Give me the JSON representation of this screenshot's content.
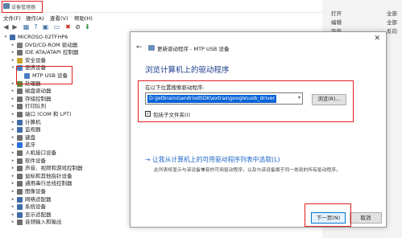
{
  "device_manager": {
    "title": "设备管理器",
    "menu": [
      "文件(F)",
      "操作(A)",
      "查看(V)",
      "帮助(H)"
    ],
    "toolbar_icons": [
      "back-icon",
      "forward-icon",
      "properties-icon",
      "help-icon",
      "refresh-icon",
      "monitor-icon",
      "remove-device-icon",
      "disable-icon",
      "update-driver-icon"
    ],
    "tree": [
      {
        "label": "MICROSO-02TFHP6",
        "level": 0,
        "expanded": true,
        "icon_color": "#3f6ca8"
      },
      {
        "label": "DVD/CD-ROM 驱动器",
        "level": 1,
        "expanded": false,
        "icon_color": "#7a7a7a"
      },
      {
        "label": "IDE ATA/ATAPI 控制器",
        "level": 1,
        "expanded": false,
        "icon_color": "#6d6d6d"
      },
      {
        "label": "安全设备",
        "level": 1,
        "expanded": false,
        "icon_color": "#c9a227"
      },
      {
        "label": "便携设备",
        "level": 1,
        "expanded": true,
        "icon_color": "#4a7fc0"
      },
      {
        "label": "MTP USB 设备",
        "level": 2,
        "expanded": null,
        "icon_color": "#4a7fc0"
      },
      {
        "label": "处理器",
        "level": 1,
        "expanded": false,
        "icon_color": "#5b8a3c"
      },
      {
        "label": "磁盘驱动器",
        "level": 1,
        "expanded": false,
        "icon_color": "#6d6d6d"
      },
      {
        "label": "存储控制器",
        "level": 1,
        "expanded": false,
        "icon_color": "#6d6d6d"
      },
      {
        "label": "打印队列",
        "level": 1,
        "expanded": false,
        "icon_color": "#6d6d6d"
      },
      {
        "label": "端口 (COM 和 LPT)",
        "level": 1,
        "expanded": false,
        "icon_color": "#6d6d6d"
      },
      {
        "label": "计算机",
        "level": 1,
        "expanded": false,
        "icon_color": "#3f6ca8"
      },
      {
        "label": "监视器",
        "level": 1,
        "expanded": false,
        "icon_color": "#3f6ca8"
      },
      {
        "label": "键盘",
        "level": 1,
        "expanded": false,
        "icon_color": "#6d6d6d"
      },
      {
        "label": "蓝牙",
        "level": 1,
        "expanded": false,
        "icon_color": "#2a6fdb"
      },
      {
        "label": "人机接口设备",
        "level": 1,
        "expanded": false,
        "icon_color": "#6d6d6d"
      },
      {
        "label": "软件设备",
        "level": 1,
        "expanded": false,
        "icon_color": "#6d6d6d"
      },
      {
        "label": "声音、视频和游戏控制器",
        "level": 1,
        "expanded": false,
        "icon_color": "#6d6d6d"
      },
      {
        "label": "鼠标和其他指针设备",
        "level": 1,
        "expanded": false,
        "icon_color": "#6d6d6d"
      },
      {
        "label": "通用串行总线控制器",
        "level": 1,
        "expanded": false,
        "icon_color": "#6d6d6d"
      },
      {
        "label": "图像设备",
        "level": 1,
        "expanded": false,
        "icon_color": "#6d6d6d"
      },
      {
        "label": "网络适配器",
        "level": 1,
        "expanded": false,
        "icon_color": "#3f6ca8"
      },
      {
        "label": "系统设备",
        "level": 1,
        "expanded": false,
        "icon_color": "#3f6ca8"
      },
      {
        "label": "显示适配器",
        "level": 1,
        "expanded": false,
        "icon_color": "#3f6ca8"
      },
      {
        "label": "音频输入和输出",
        "level": 1,
        "expanded": false,
        "icon_color": "#6d6d6d"
      }
    ]
  },
  "ribbon_peek": {
    "open_label": "打开",
    "edit_label": "编辑",
    "history_label": "历史",
    "select_all_label": "全部",
    "select_none_label": "全部",
    "invert_label": "反向"
  },
  "wizard": {
    "window_title": "更新驱动程序 - MTP USB 设备",
    "heading": "浏览计算机上的驱动程序",
    "search_label": "在以下位置搜索驱动程序:",
    "path_value": "D:\\Jetbrains\\andriodSDK\\extras\\google\\usb_driver",
    "browse_label": "浏览(R)...",
    "include_subfolders_label": "包括子文件夹(I)",
    "include_subfolders_checked": true,
    "pick_title": "→  让我从计算机上的可用驱动程序列表中选取(L)",
    "pick_description": "此列表将显示与该设备兼容的可用驱动程序，以及与该设备属于同一类别的所有驱动程序。",
    "next_label": "下一页(N)",
    "cancel_label": "取消"
  },
  "colors": {
    "highlight_red": "#e02020",
    "heading_blue": "#1c3d8c",
    "link_blue": "#1c66c6",
    "selection_blue": "#0a64d8"
  }
}
